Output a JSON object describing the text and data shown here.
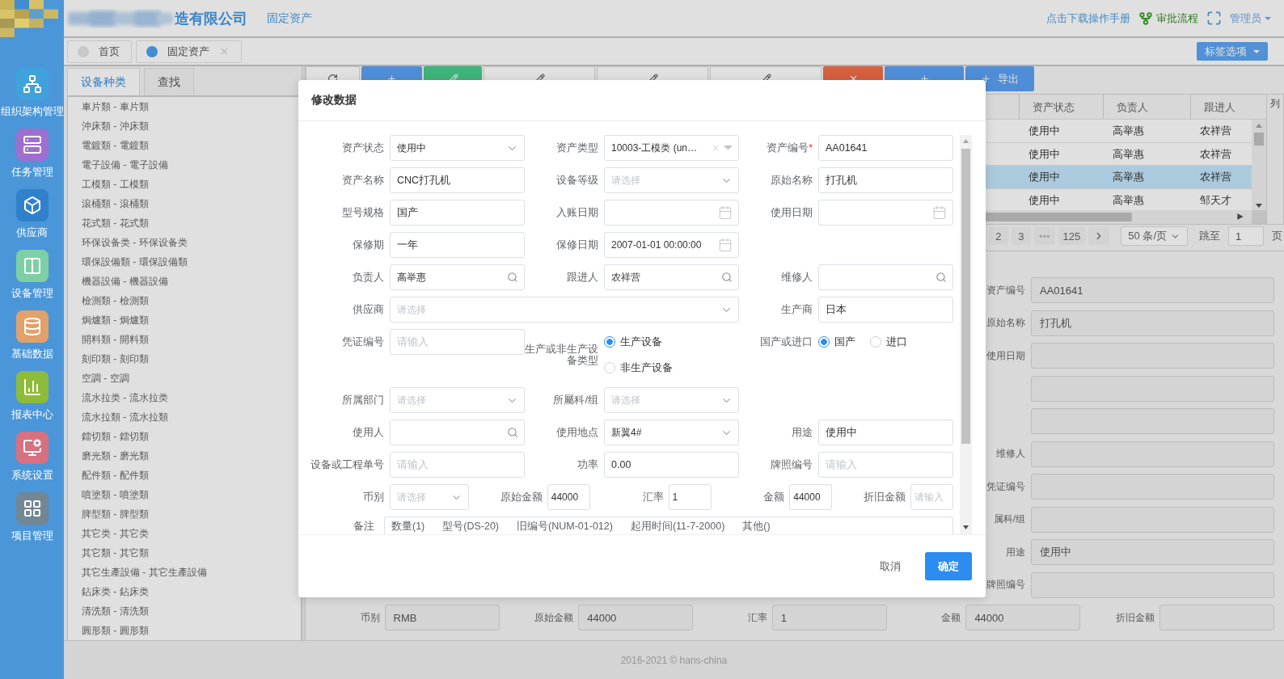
{
  "header": {
    "company": "造有限公司",
    "module": "固定资产",
    "links": [
      {
        "kind": "manual",
        "label": "点击下载操作手册"
      },
      {
        "kind": "workflow",
        "label": "审批流程"
      },
      {
        "kind": "fullscreen"
      },
      {
        "kind": "user",
        "label": "管理员"
      }
    ]
  },
  "sidebar": {
    "items": [
      {
        "kind": "org",
        "label": "组织架构管理",
        "color": "#40a2dc"
      },
      {
        "kind": "tasks",
        "label": "任务管理",
        "color": "#9e6fcf"
      },
      {
        "kind": "supplier",
        "label": "供应商",
        "color": "#3180cc"
      },
      {
        "kind": "device",
        "label": "设备管理",
        "color": "#7ecfa6"
      },
      {
        "kind": "data",
        "label": "基础数据",
        "color": "#e2a06a"
      },
      {
        "kind": "report",
        "label": "报表中心",
        "color": "#8fbb3b"
      },
      {
        "kind": "settings",
        "label": "系统设置",
        "color": "#d7707f"
      },
      {
        "kind": "project",
        "label": "项目管理",
        "color": "#738693"
      }
    ]
  },
  "page_tabs": {
    "tabs": [
      {
        "label": "首页",
        "selected": false,
        "closable": false
      },
      {
        "label": "固定资产",
        "selected": true,
        "closable": true
      }
    ],
    "options_button": "标签选项"
  },
  "category_panel": {
    "tabs": [
      {
        "label": "设备种类",
        "selected": true
      },
      {
        "label": "查找",
        "selected": false
      }
    ],
    "items": [
      "車片類 - 車片類",
      "沖床類 - 沖床類",
      "電鍍類 - 電鍍類",
      "電子設備 - 電子設備",
      "工模類 - 工模類",
      "滾桶類 - 滾桶類",
      "花式類 - 花式類",
      "环保设备类 - 环保设备类",
      "環保設備類 - 環保設備類",
      "機器設備 - 機器設備",
      "檢測類 - 檢測類",
      "焗爐類 - 焗爐類",
      "開料類 - 開料類",
      "刻印類 - 刻印類",
      "空調 - 空調",
      "流水拉类 - 流水拉类",
      "流水拉類 - 流水拉類",
      "鐳切類 - 鐳切類",
      "磨光類 - 磨光類",
      "配件類 - 配件類",
      "噴塗類 - 噴塗類",
      "脾型類 - 脾型類",
      "其它类 - 其它类",
      "其它類 - 其它類",
      "其它生產設備 - 其它生產設備",
      "鉆床类 - 鉆床类",
      "清洗類 - 清洗類",
      "圓形類 - 圓形類"
    ]
  },
  "toolbar": {
    "buttons": [
      {
        "kind": "refresh"
      },
      {
        "kind": "add"
      },
      {
        "kind": "edit"
      },
      {
        "kind": "batch"
      },
      {
        "kind": "batch"
      },
      {
        "kind": "batch"
      },
      {
        "kind": "delete"
      },
      {
        "kind": "import"
      },
      {
        "kind": "export",
        "label": "导出"
      }
    ]
  },
  "grid": {
    "columns": [
      "资产状态",
      "负责人",
      "跟进人"
    ],
    "rows": [
      {
        "cells": [
          "使用中",
          "高举惠",
          "农祥营"
        ],
        "selected": false
      },
      {
        "cells": [
          "使用中",
          "高举惠",
          "农祥营"
        ],
        "selected": false
      },
      {
        "cells": [
          "使用中",
          "高举惠",
          "农祥营"
        ],
        "selected": true
      },
      {
        "cells": [
          "使用中",
          "高举惠",
          "邹天才"
        ],
        "selected": false
      }
    ],
    "column_button": "列"
  },
  "pager": {
    "pages": [
      "2",
      "3"
    ],
    "ellipsis": "•••",
    "last_page": "125",
    "page_size": "50 条/页",
    "jump_label": "跳至",
    "jump_value": "1",
    "suffix": "页"
  },
  "detail": {
    "rows": [
      {
        "label": "资产编号",
        "value": "AA01641",
        "disabled": true
      },
      {
        "label": "原始名称",
        "value": "打孔机",
        "disabled": true
      },
      {
        "label": "使用日期",
        "disabled": true
      },
      {
        "disabled": true
      },
      {
        "disabled": true
      },
      {
        "label": "维修人",
        "disabled": true
      },
      {
        "label": "凭证编号",
        "disabled": true
      },
      {
        "label": "属科/组",
        "disabled": true
      },
      {
        "label": "用途",
        "value": "使用中",
        "disabled": true
      },
      {
        "label": "牌照编号",
        "disabled": true
      }
    ],
    "bottom_row": [
      {
        "label": "币别",
        "value": "RMB",
        "disabled": true
      },
      {
        "label": "原始金额",
        "value": "44000",
        "disabled": true
      },
      {
        "label": "汇率",
        "value": "1",
        "disabled": true
      },
      {
        "label": "金额",
        "value": "44000",
        "disabled": true
      },
      {
        "label": "折旧金额",
        "disabled": true
      }
    ]
  },
  "footer": "2016-2021 © hans-china",
  "modal": {
    "title": "修改数据",
    "rows": [
      {
        "kind": "triple",
        "fields": [
          {
            "label": "资产状态",
            "kind": "select",
            "value": "使用中"
          },
          {
            "label": "资产类型",
            "kind": "select",
            "value": "10003-工模类 (un…",
            "clearable": true
          },
          {
            "label": "资产编号",
            "required_mark": "*",
            "kind": "input",
            "value": "AA01641"
          }
        ]
      },
      {
        "kind": "triple",
        "fields": [
          {
            "label": "资产名称",
            "kind": "input",
            "value": "CNC打孔机"
          },
          {
            "label": "设备等级",
            "kind": "select",
            "placeholder": "请选择"
          },
          {
            "label": "原始名称",
            "kind": "input",
            "value": "打孔机"
          }
        ]
      },
      {
        "kind": "triple",
        "fields": [
          {
            "label": "型号规格",
            "kind": "input",
            "value": "国产"
          },
          {
            "label": "入账日期",
            "kind": "date"
          },
          {
            "label": "使用日期",
            "kind": "date"
          }
        ]
      },
      {
        "kind": "triple",
        "fields": [
          {
            "label": "保修期",
            "kind": "input",
            "value": "一年"
          },
          {
            "label": "保修日期",
            "kind": "date",
            "value": "2007-01-01 00:00:00"
          }
        ]
      },
      {
        "kind": "triple",
        "fields": [
          {
            "label": "负责人",
            "kind": "search",
            "value": "高举惠"
          },
          {
            "label": "跟进人",
            "kind": "search",
            "value": "农祥营"
          },
          {
            "label": "维修人",
            "kind": "search"
          }
        ]
      },
      {
        "kind": "triple",
        "fields": [
          {
            "label": "供应商",
            "kind": "select",
            "placeholder": "请选择",
            "wide": true
          },
          {
            "label": "生产商",
            "kind": "input",
            "value": "日本"
          }
        ]
      },
      {
        "kind": "triple",
        "fields": [
          {
            "label": "凭证编号",
            "kind": "input",
            "placeholder": "请输入"
          },
          {
            "label": "生产或非生产设备类型",
            "kind": "radio",
            "options": [
              {
                "label": "生产设备",
                "selected": true
              },
              {
                "label": "非生产设备",
                "selected": false
              }
            ]
          },
          {
            "label": "国产或进口",
            "kind": "radio",
            "options": [
              {
                "label": "国产",
                "selected": true
              },
              {
                "label": "进口",
                "selected": false
              }
            ]
          }
        ]
      },
      {
        "kind": "triple",
        "fields": [
          {
            "label": "所属部门",
            "kind": "select",
            "placeholder": "请选择"
          },
          {
            "label": "所屬科/组",
            "kind": "select",
            "placeholder": "请选择"
          }
        ]
      },
      {
        "kind": "triple",
        "fields": [
          {
            "label": "使用人",
            "kind": "search"
          },
          {
            "label": "使用地点",
            "kind": "select",
            "value": "新翼4#"
          },
          {
            "label": "用途",
            "kind": "input",
            "value": "使用中"
          }
        ]
      },
      {
        "kind": "triple",
        "fields": [
          {
            "label": "设备或工程单号",
            "kind": "input",
            "placeholder": "请输入"
          },
          {
            "label": "功率",
            "kind": "input",
            "value": "0.00"
          },
          {
            "label": "牌照编号",
            "kind": "input",
            "placeholder": "请输入"
          }
        ]
      },
      {
        "kind": "money",
        "fields": [
          {
            "label": "币别",
            "kind": "select",
            "placeholder": "请选择"
          },
          {
            "label": "原始金额",
            "kind": "input",
            "value": "44000"
          },
          {
            "label": "汇率",
            "kind": "input",
            "value": "1"
          },
          {
            "label": "金额",
            "kind": "input",
            "value": "44000"
          },
          {
            "label": "折旧金额",
            "kind": "input",
            "placeholder": "请输入"
          }
        ]
      },
      {
        "kind": "memo",
        "label": "备注",
        "items": [
          "数量(1)",
          "型号(DS-20)",
          "旧编号(NUM-01-012)",
          "起用时间(11-7-2000)",
          "其他()"
        ]
      }
    ],
    "buttons": [
      {
        "kind": "default",
        "label": "取消"
      },
      {
        "kind": "primary",
        "label": "确定"
      }
    ]
  }
}
